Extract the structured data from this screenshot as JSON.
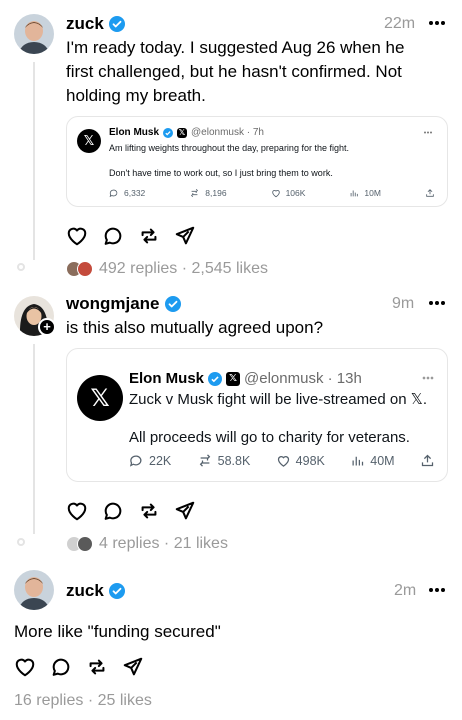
{
  "posts": [
    {
      "username": "zuck",
      "time": "22m",
      "text": "I'm ready today. I suggested Aug 26 when he first challenged, but he hasn't confirmed. Not holding my breath.",
      "quote": {
        "name": "Elon Musk",
        "handle": "@elonmusk · 7h",
        "line1": "Am lifting weights throughout the day, preparing for the fight.",
        "line2": "Don't have time to work out, so I just bring them to work.",
        "replies": "6,332",
        "reposts": "8,196",
        "likes": "106K",
        "views": "10M"
      },
      "meta": "492 replies · 2,545 likes"
    },
    {
      "username": "wongmjane",
      "time": "9m",
      "text": "is this also mutually agreed upon?",
      "quote": {
        "name": "Elon Musk",
        "handle": "@elonmusk · 13h",
        "line1": "Zuck v Musk fight will be live-streamed on 𝕏.",
        "line2": "All proceeds will go to charity for veterans.",
        "replies": "22K",
        "reposts": "58.8K",
        "likes": "498K",
        "views": "40M"
      },
      "meta": "4 replies · 21 likes"
    },
    {
      "username": "zuck",
      "time": "2m",
      "text": "More like \"funding secured\"",
      "meta": "16 replies · 25 likes"
    }
  ],
  "icons": [
    "verified-badge-icon",
    "more-icon",
    "heart-icon",
    "reply-icon",
    "repost-icon",
    "share-icon",
    "views-icon",
    "upload-icon",
    "x-logo-icon",
    "follow-plus-icon"
  ],
  "colors": {
    "verified": "#1d9bf0",
    "muted": "#9a9a9a",
    "line": "#e4e4e4"
  }
}
